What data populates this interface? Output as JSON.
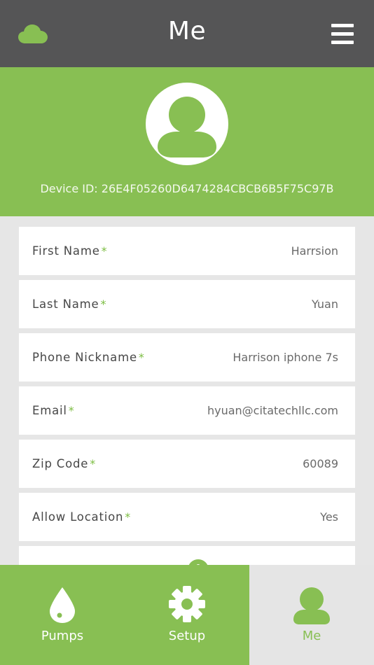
{
  "header": {
    "title": "Me",
    "left_icon": "cloud-icon",
    "right_icon": "menu-icon"
  },
  "profile": {
    "device_label": "Device ID: 26E4F05260D6474284CBCB6B5F75C97B",
    "avatar_icon": "user-avatar-icon"
  },
  "form": {
    "required_marker": "*",
    "fields": [
      {
        "label": "First Name",
        "value": "Harrsion"
      },
      {
        "label": "Last Name",
        "value": "Yuan"
      },
      {
        "label": "Phone Nickname",
        "value": "Harrison iphone 7s"
      },
      {
        "label": "Email",
        "value": "hyuan@citatechllc.com"
      },
      {
        "label": "Zip Code",
        "value": "60089"
      },
      {
        "label": "Allow Location",
        "value": "Yes"
      }
    ],
    "partial_row_icon": "location-pin-icon"
  },
  "nav": {
    "tabs": [
      {
        "label": "Pumps",
        "icon": "water-drop-icon",
        "active": false
      },
      {
        "label": "Setup",
        "icon": "gear-icon",
        "active": false
      },
      {
        "label": "Me",
        "icon": "user-icon",
        "active": true
      }
    ]
  },
  "colors": {
    "header_bg": "#555556",
    "accent": "#88bf53",
    "required": "#7cbd42",
    "page_bg": "#e6e6e6"
  }
}
